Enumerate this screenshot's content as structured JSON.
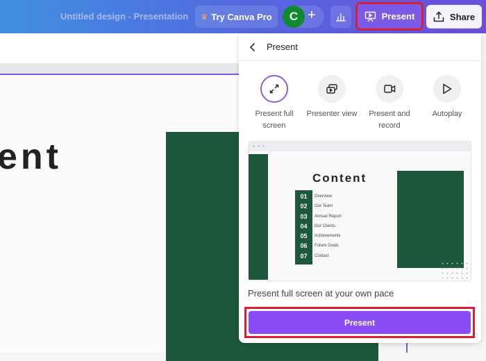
{
  "header": {
    "doc_title": "Untitled design - Presentation",
    "try_pro_label": "Try Canva Pro",
    "avatar_initial": "C",
    "add_icon": "plus-icon",
    "analytics_icon": "bar-chart-icon",
    "present_label": "Present",
    "share_label": "Share"
  },
  "canvas": {
    "title_fragment": "ent"
  },
  "panel": {
    "title": "Present",
    "options": [
      {
        "label": "Present full screen",
        "icon": "expand-arrows-icon",
        "selected": true
      },
      {
        "label": "Presenter view",
        "icon": "presenter-view-icon",
        "selected": false
      },
      {
        "label": "Present and record",
        "icon": "video-camera-icon",
        "selected": false
      },
      {
        "label": "Autoplay",
        "icon": "play-icon",
        "selected": false
      }
    ],
    "preview": {
      "title": "Content",
      "items": [
        {
          "num": "01",
          "label": "Overview"
        },
        {
          "num": "02",
          "label": "Our Team"
        },
        {
          "num": "03",
          "label": "Annual Report"
        },
        {
          "num": "04",
          "label": "Our Clients"
        },
        {
          "num": "05",
          "label": "Achievements"
        },
        {
          "num": "06",
          "label": "Future Goals"
        },
        {
          "num": "07",
          "label": "Contact"
        }
      ]
    },
    "caption": "Present full screen at your own pace",
    "present_button": "Present"
  },
  "colors": {
    "accent_purple": "#8a4df5",
    "highlight_red": "#d81f35",
    "slide_green": "#1d583b"
  }
}
